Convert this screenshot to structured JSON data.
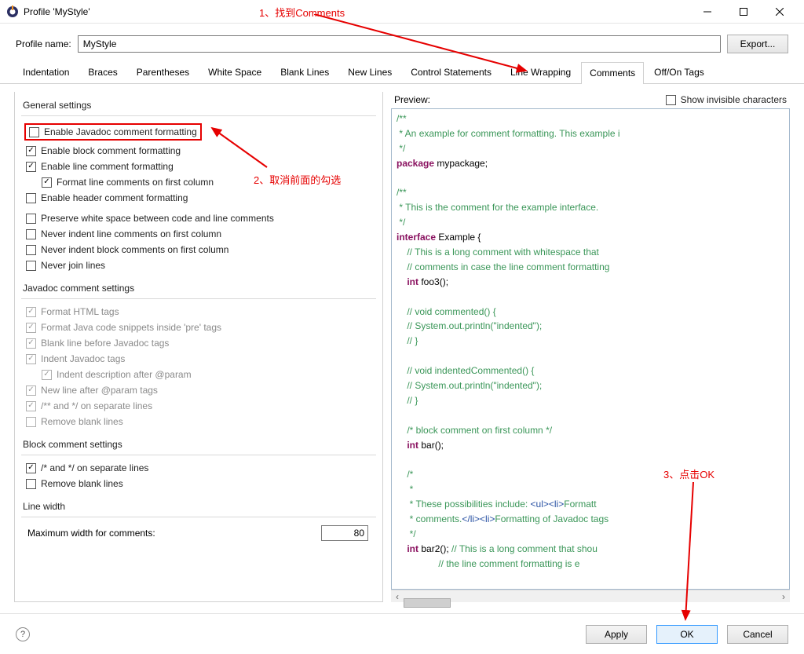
{
  "window": {
    "title": "Profile 'MyStyle'"
  },
  "profile": {
    "label": "Profile name:",
    "value": "MyStyle",
    "export": "Export..."
  },
  "tabs": [
    "Indentation",
    "Braces",
    "Parentheses",
    "White Space",
    "Blank Lines",
    "New Lines",
    "Control Statements",
    "Line Wrapping",
    "Comments",
    "Off/On Tags"
  ],
  "active_tab": 8,
  "annotations": {
    "a1": "1、找到Comments",
    "a2": "2、取消前面的勾选",
    "a3": "3、点击OK"
  },
  "settings": {
    "general": {
      "legend": "General settings",
      "items": [
        {
          "id": "javadoc",
          "label": "Enable Javadoc comment formatting",
          "checked": false
        },
        {
          "id": "block",
          "label": "Enable block comment formatting",
          "checked": true
        },
        {
          "id": "line",
          "label": "Enable line comment formatting",
          "checked": true
        },
        {
          "id": "linecol",
          "label": "Format line comments on first column",
          "checked": true,
          "indent": 1
        },
        {
          "id": "header",
          "label": "Enable header comment formatting",
          "checked": false
        },
        {
          "id": "preserve",
          "label": "Preserve white space between code and line comments",
          "checked": false
        },
        {
          "id": "neverline",
          "label": "Never indent line comments on first column",
          "checked": false
        },
        {
          "id": "neverblock",
          "label": "Never indent block comments on first column",
          "checked": false
        },
        {
          "id": "neverjoin",
          "label": "Never join lines",
          "checked": false
        }
      ]
    },
    "javadoc": {
      "legend": "Javadoc comment settings",
      "items": [
        {
          "id": "fhtml",
          "label": "Format HTML tags",
          "checked": true,
          "disabled": true
        },
        {
          "id": "fjava",
          "label": "Format Java code snippets inside 'pre' tags",
          "checked": true,
          "disabled": true
        },
        {
          "id": "bline",
          "label": "Blank line before Javadoc tags",
          "checked": true,
          "disabled": true
        },
        {
          "id": "ijtags",
          "label": "Indent Javadoc tags",
          "checked": true,
          "disabled": true
        },
        {
          "id": "idesc",
          "label": "Indent description after @param",
          "checked": true,
          "disabled": true,
          "indent": 1
        },
        {
          "id": "newline",
          "label": "New line after @param tags",
          "checked": true,
          "disabled": true
        },
        {
          "id": "sep1",
          "label": "/** and */ on separate lines",
          "checked": true,
          "disabled": true
        },
        {
          "id": "rblank",
          "label": "Remove blank lines",
          "checked": false,
          "disabled": true
        }
      ]
    },
    "block": {
      "legend": "Block comment settings",
      "items": [
        {
          "id": "bsep",
          "label": "/* and */ on separate lines",
          "checked": true
        },
        {
          "id": "brblank",
          "label": "Remove blank lines",
          "checked": false
        }
      ]
    },
    "linewidth": {
      "legend": "Line width",
      "label": "Maximum width for comments:",
      "value": "80"
    }
  },
  "preview": {
    "label": "Preview:",
    "invisible": "Show invisible characters",
    "invisible_checked": false
  },
  "code": {
    "l1": "/**",
    "l2": " * An example for comment formatting. This example i",
    "l3": " */",
    "l4a": "package",
    "l4b": " mypackage;",
    "l6": "/**",
    "l7": " * This is the comment for the example interface.",
    "l8": " */",
    "l9a": "interface",
    "l9b": " Example {",
    "l10": "    // This is a long comment with whitespace that ",
    "l11": "    // comments in case the line comment formatting",
    "l12a": "    ",
    "l12b": "int",
    "l12c": " foo3();",
    "l14": "    // void commented() {",
    "l15": "    // System.out.println(\"indented\");",
    "l16": "    // }",
    "l18": "    // void indentedCommented() {",
    "l19": "    // System.out.println(\"indented\");",
    "l20": "    // }",
    "l22": "    /* block comment on first column */",
    "l23a": "    ",
    "l23b": "int",
    "l23c": " bar();",
    "l25": "    /*",
    "l26": "     *",
    "l27a": "     * These possibilities include: ",
    "l27b": "<ul><li>",
    "l27c": "Formatt",
    "l28a": "     * comments.",
    "l28b": "</li><li>",
    "l28c": "Formatting of Javadoc tags",
    "l29": "     */",
    "l30a": "    ",
    "l30b": "int",
    "l30c": " bar2(); ",
    "l30d": "// This is a long comment that shou",
    "l31": "                // the line comment formatting is e"
  },
  "footer": {
    "apply": "Apply",
    "ok": "OK",
    "cancel": "Cancel"
  }
}
